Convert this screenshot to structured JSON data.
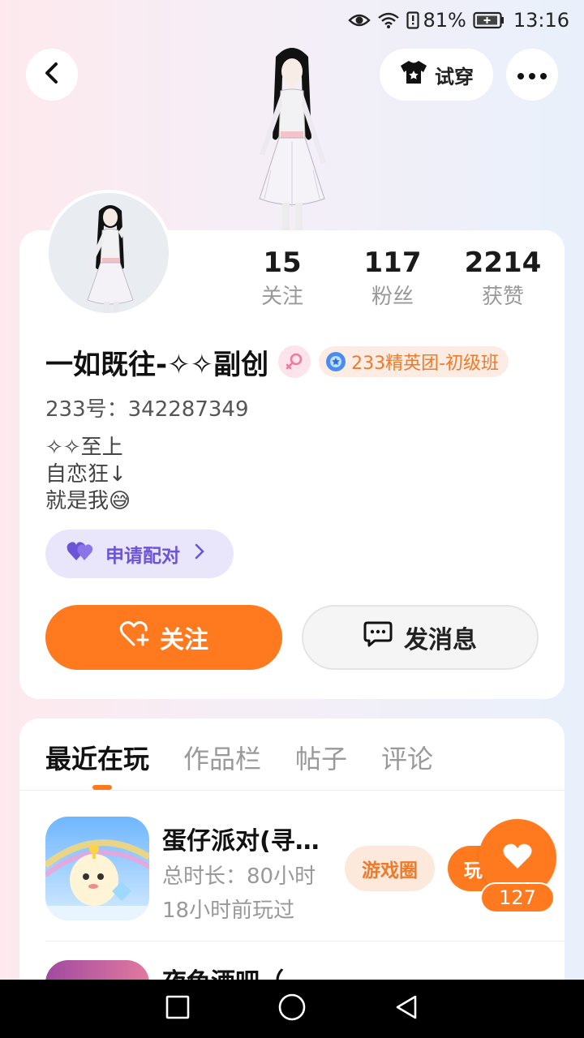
{
  "status_bar": {
    "battery_percent": "81%",
    "time": "13:16"
  },
  "header": {
    "try_on_label": "试穿"
  },
  "profile": {
    "stats": [
      {
        "value": "15",
        "label": "关注"
      },
      {
        "value": "117",
        "label": "粉丝"
      },
      {
        "value": "2214",
        "label": "获赞"
      }
    ],
    "name": "一如既往-✧✧副创",
    "badge_label": "233精英团-初级班",
    "uid": "233号：342287349",
    "bio": [
      "✧✧至上",
      "自恋狂↓",
      "就是我😅"
    ],
    "match_label": "申请配对",
    "follow_label": "关注",
    "message_label": "发消息"
  },
  "tabs": [
    {
      "label": "最近在玩",
      "active": true
    },
    {
      "label": "作品栏",
      "active": false
    },
    {
      "label": "帖子",
      "active": false
    },
    {
      "label": "评论",
      "active": false
    }
  ],
  "games": [
    {
      "title": "蛋仔派对(寻…",
      "total_time": "总时长：80小时",
      "last_played": "18小时前玩过",
      "circle_label": "游戏圈",
      "play_label": "玩"
    },
    {
      "title": "夜色酒吧（"
    }
  ],
  "likes": {
    "count": "127"
  },
  "colors": {
    "accent": "#ff7a1f",
    "match_bg": "#e9e5fb",
    "match_text": "#6c54d8"
  },
  "icons": {
    "eye": "eye-icon",
    "wifi": "wifi-icon",
    "sim": "sim-icon",
    "battery": "battery-icon",
    "back": "back-arrow-icon",
    "shirt": "shirt-icon",
    "more": "more-dots-icon",
    "gender": "female-icon",
    "heart": "heart-icon",
    "chat": "chat-bubble-icon"
  }
}
